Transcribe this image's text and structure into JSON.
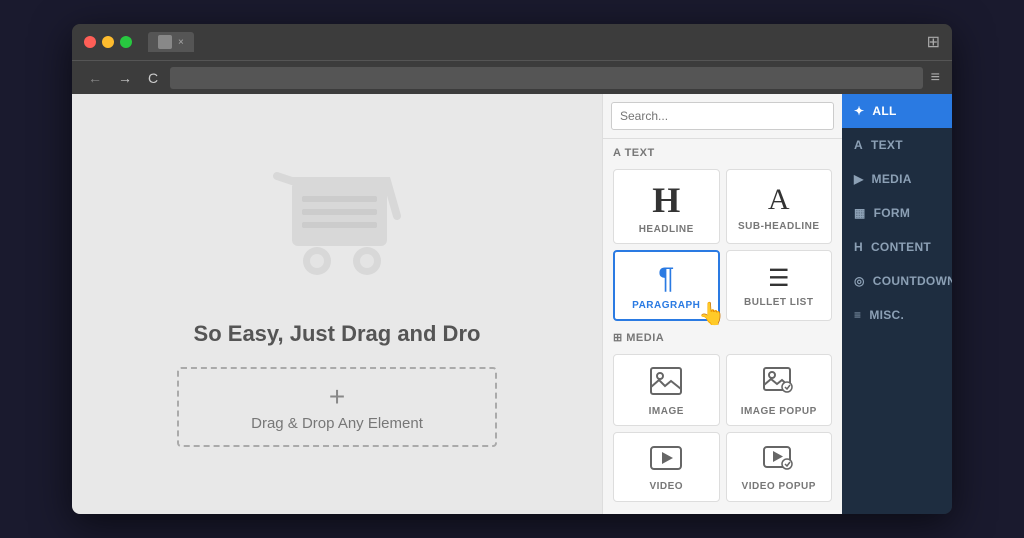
{
  "browser": {
    "traffic_lights": [
      "red",
      "yellow",
      "green"
    ],
    "tab_label": "",
    "close_label": "×",
    "url": "",
    "hamburger": "≡",
    "nav_back": "←",
    "nav_forward": "→",
    "nav_refresh": "C"
  },
  "canvas": {
    "headline_text": "So Easy, Just Drag and Dro",
    "drop_zone_plus": "+",
    "drop_zone_label": "Drag & Drop Any Element"
  },
  "element_panel": {
    "search_placeholder": "Search...",
    "text_section_label": "A  TEXT",
    "media_section_label": "⊞  MEDIA",
    "elements_text": [
      {
        "label": "HEADLINE",
        "icon": "H"
      },
      {
        "label": "SUB-HEADLINE",
        "icon": "A"
      },
      {
        "label": "PARAGRAPH",
        "icon": "¶",
        "active": true
      },
      {
        "label": "BULLET LIST",
        "icon": "≡"
      }
    ],
    "elements_media": [
      {
        "label": "IMAGE",
        "icon": "🖼"
      },
      {
        "label": "IMAGE POPUP",
        "icon": "🔍"
      },
      {
        "label": "VIDEO",
        "icon": "▶"
      },
      {
        "label": "VIDEO POPUP",
        "icon": "▶"
      }
    ]
  },
  "sidebar": {
    "items": [
      {
        "label": "ALL",
        "icon": "✦",
        "active": true
      },
      {
        "label": "TEXT",
        "icon": "A"
      },
      {
        "label": "MEDIA",
        "icon": "▶"
      },
      {
        "label": "FORM",
        "icon": "▦"
      },
      {
        "label": "CONTENT",
        "icon": "H"
      },
      {
        "label": "COUNTDOWN",
        "icon": "◎"
      },
      {
        "label": "MISC.",
        "icon": "≡"
      }
    ]
  }
}
